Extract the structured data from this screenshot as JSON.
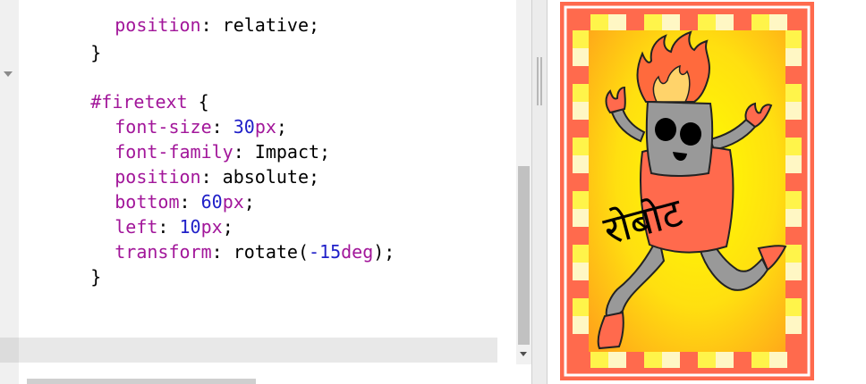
{
  "editor": {
    "lines": [
      {
        "prop": "position",
        "value": "relative"
      },
      {
        "text": "}"
      },
      {
        "selector": "#firetext",
        "brace": " {"
      },
      {
        "prop": "font-size",
        "num": "30",
        "unit": "px"
      },
      {
        "prop": "font-family",
        "value": "Impact"
      },
      {
        "prop": "position",
        "value": "absolute"
      },
      {
        "prop": "bottom",
        "num": "60",
        "unit": "px"
      },
      {
        "prop": "left",
        "num": "10",
        "unit": "px"
      },
      {
        "prop": "transform",
        "value_prefix": "rotate(",
        "num": "-15",
        "unit": "deg",
        "value_suffix": ");"
      },
      {
        "text": "}"
      }
    ]
  },
  "preview": {
    "card_text": "रोबोट",
    "colors": {
      "border": "#ff6a4d",
      "stripe_yellow": "#fff44a",
      "stripe_cream": "#fff7c4",
      "gradient_center": "#ffff00",
      "gradient_edge": "#ffa21a",
      "robot_gray": "#999999",
      "robot_shirt": "#ff6a4d",
      "flame_outer": "#ff6a3d",
      "flame_inner": "#ffd36a"
    }
  }
}
